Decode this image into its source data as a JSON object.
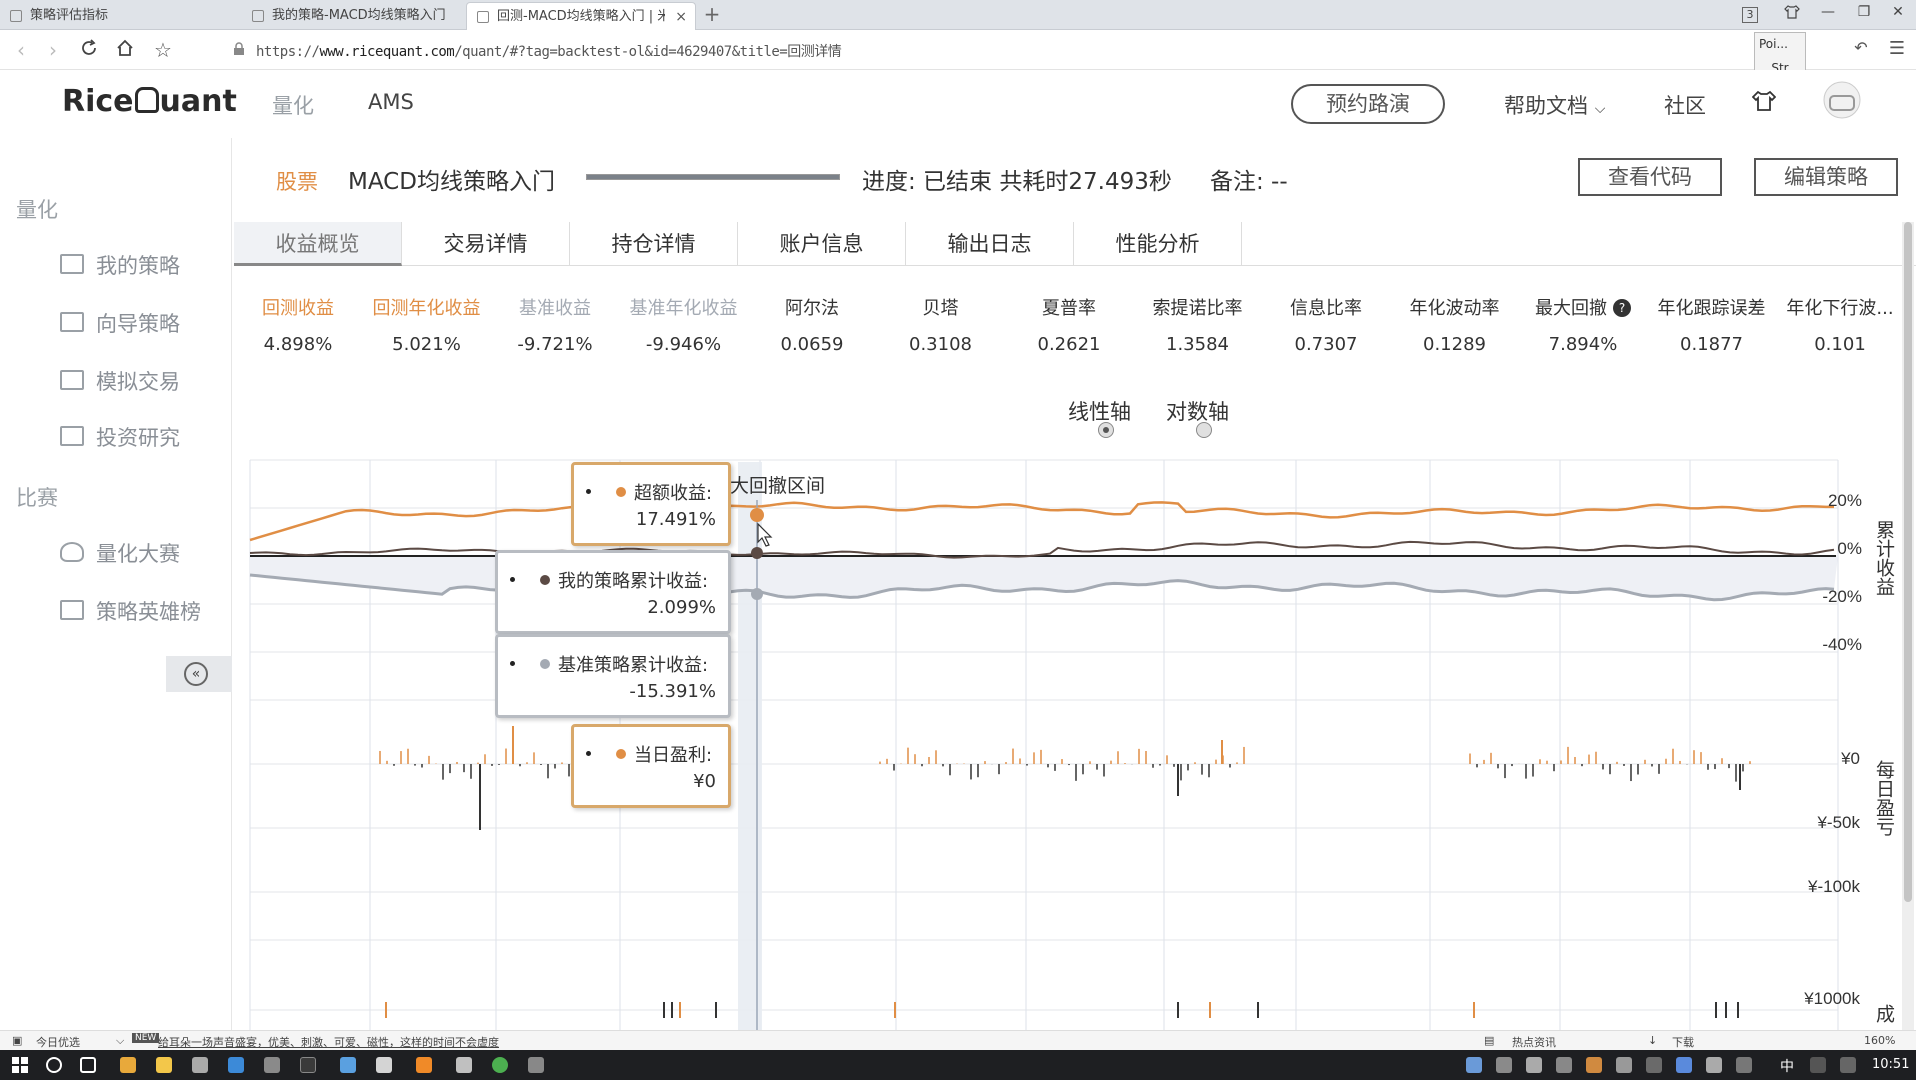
{
  "browser": {
    "tabs": [
      {
        "label": "策略评估指标"
      },
      {
        "label": "我的策略-MACD均线策略入门"
      },
      {
        "label": "回测-MACD均线策略入门 | 米筐",
        "close": "×"
      }
    ],
    "new_tab": "+",
    "tab_count": "3",
    "url_prefix": "https://",
    "url_host": "www.ricequant.com",
    "url_path": "/quant/#?tag=backtest-ol&id=4629407&title=回测详情",
    "extension_lines": [
      "Poi...",
      "Str"
    ]
  },
  "header": {
    "logo_left": "Rice",
    "logo_right": "uant",
    "nav": [
      "量化",
      "AMS"
    ],
    "roadshow": "预约路演",
    "help": "帮助文档",
    "community": "社区"
  },
  "sidebar": {
    "sections": [
      {
        "title": "量化",
        "items": [
          "我的策略",
          "向导策略",
          "模拟交易",
          "投资研究"
        ]
      },
      {
        "title": "比赛",
        "items": [
          "量化大赛",
          "策略英雄榜"
        ]
      }
    ],
    "collapse": "«"
  },
  "strategy": {
    "tag": "股票",
    "name": "MACD均线策略入门",
    "progress_fraction": 1.0,
    "progress_text": "进度: 已结束 共耗时27.493秒",
    "remark": "备注: --",
    "view_code": "查看代码",
    "edit": "编辑策略"
  },
  "tabs": [
    "收益概览",
    "交易详情",
    "持仓详情",
    "账户信息",
    "输出日志",
    "性能分析"
  ],
  "metrics": [
    {
      "label": "回测收益",
      "value": "4.898%",
      "color": "#e08e45"
    },
    {
      "label": "回测年化收益",
      "value": "5.021%",
      "color": "#e08e45"
    },
    {
      "label": "基准收益",
      "value": "-9.721%",
      "color": "#a4aab3"
    },
    {
      "label": "基准年化收益",
      "value": "-9.946%",
      "color": "#a4aab3"
    },
    {
      "label": "阿尔法",
      "value": "0.0659",
      "color": "#333333"
    },
    {
      "label": "贝塔",
      "value": "0.3108",
      "color": "#333333"
    },
    {
      "label": "夏普率",
      "value": "0.2621",
      "color": "#333333"
    },
    {
      "label": "索提诺比率",
      "value": "1.3584",
      "color": "#333333"
    },
    {
      "label": "信息比率",
      "value": "0.7307",
      "color": "#333333"
    },
    {
      "label": "年化波动率",
      "value": "0.1289",
      "color": "#333333"
    },
    {
      "label": "最大回撤",
      "value": "7.894%",
      "color": "#333333"
    },
    {
      "label": "年化跟踪误差",
      "value": "0.1877",
      "color": "#333333"
    },
    {
      "label": "年化下行波...",
      "value": "0.101",
      "color": "#333333"
    }
  ],
  "axis_toggle": {
    "linear": "线性轴",
    "log": "对数轴",
    "selected": "linear"
  },
  "chart_labels": {
    "cum_axis": [
      "20%",
      "0%",
      "-20%",
      "-40%"
    ],
    "cum_title": "累计收益",
    "daily_axis": [
      "¥0",
      "¥-50k",
      "¥-100k"
    ],
    "daily_title": "每日盈亏",
    "volume_axis": [
      "¥1000k"
    ],
    "volume_title": "成",
    "drawdown_label": "大回撤区间"
  },
  "tooltips": {
    "excess": {
      "label": "超额收益:",
      "value": "17.491%",
      "color": "#e08e45"
    },
    "strategy": {
      "label": "我的策略累计收益:",
      "value": "2.099%",
      "color": "#5b4a44"
    },
    "benchmark": {
      "label": "基准策略累计收益:",
      "value": "-15.391%",
      "color": "#9ea6b4"
    },
    "daily": {
      "label": "当日盈利:",
      "value": "¥0",
      "color": "#e08e45"
    }
  },
  "colors": {
    "orange": "#e08e45",
    "dark": "#5b4a44",
    "gray": "#a4aab3"
  },
  "taskbar": {
    "today_pick": "今日优选",
    "news": "给耳朵一场声音盛宴，优美、刺激、可爱、磁性，这样的时间不会虚度",
    "hot": "热点资讯",
    "download": "下载",
    "zoom": "160%",
    "lang": "中",
    "time": "10:51"
  }
}
